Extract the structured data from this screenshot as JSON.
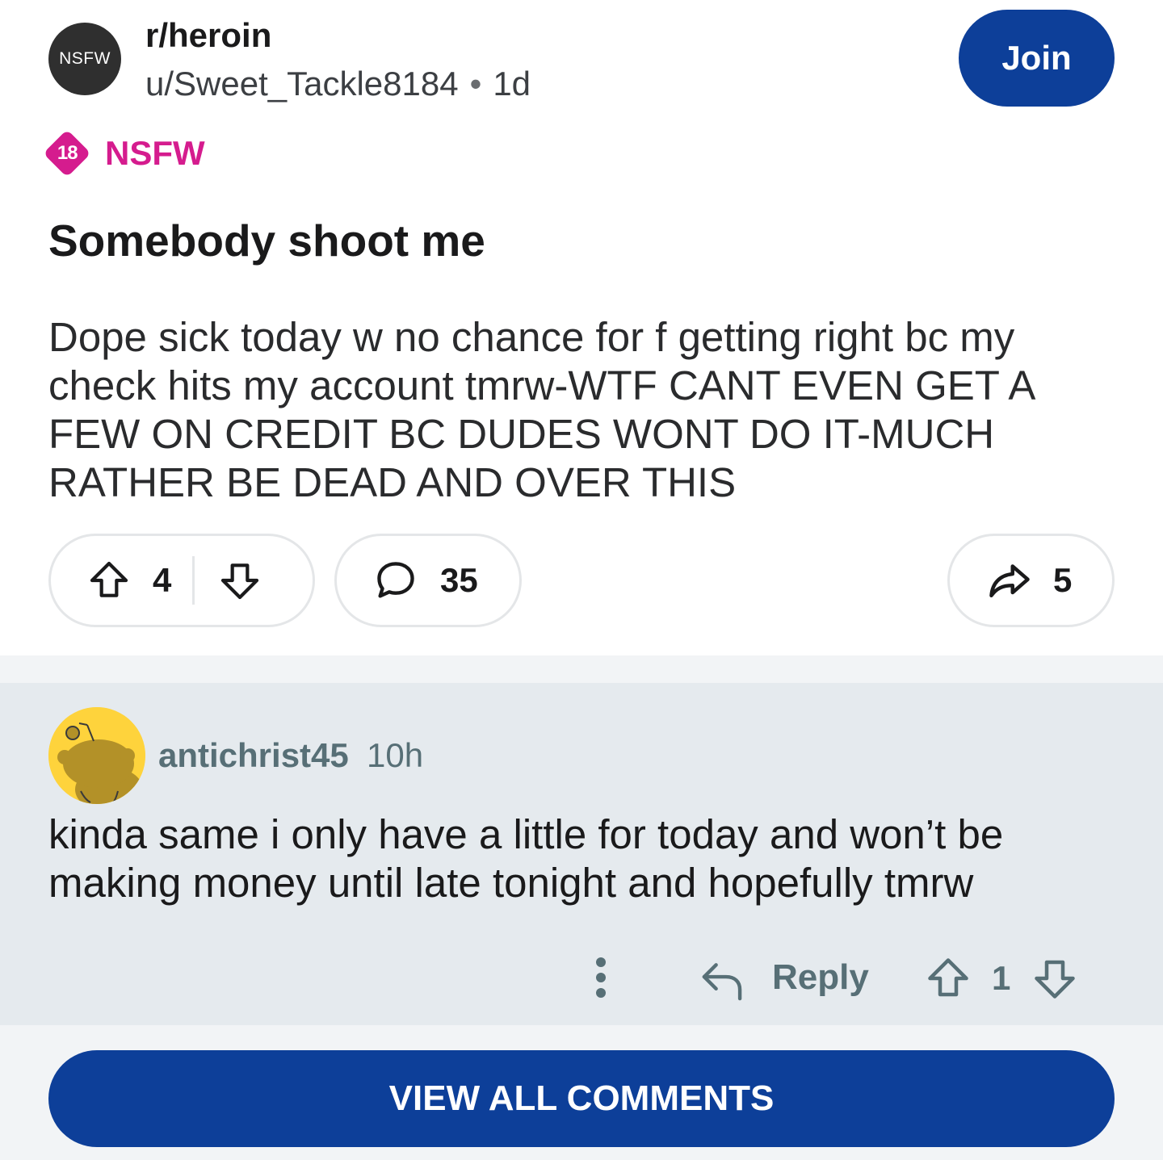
{
  "post": {
    "avatar_label": "NSFW",
    "subreddit": "r/heroin",
    "author": "u/Sweet_Tackle8184",
    "separator": "•",
    "age": "1d",
    "join_label": "Join",
    "nsfw_age": "18",
    "nsfw_label": "NSFW",
    "title": "Somebody shoot me",
    "body": "Dope sick today w no chance for f getting right bc my check hits my account tmrw-WTF CANT EVEN GET A FEW ON CREDIT BC DUDES WONT DO IT-MUCH RATHER BE DEAD AND OVER THIS",
    "upvotes": "4",
    "comments": "35",
    "shares": "5"
  },
  "comment": {
    "username": "antichrist45",
    "age": "10h",
    "body": "kinda same i only have a little for today and won’t be making money until late tonight and hopefully tmrw",
    "reply_label": "Reply",
    "votes": "1"
  },
  "footer": {
    "view_all_label": "VIEW ALL COMMENTS"
  },
  "colors": {
    "brand_blue": "#0d3f99",
    "nsfw_pink": "#d51c8e",
    "comment_bg": "#e5eaee",
    "avatar_yellow": "#fed33c"
  },
  "icons": [
    "upvote-icon",
    "downvote-icon",
    "comment-icon",
    "share-icon",
    "more-icon",
    "reply-icon",
    "snoo-avatar-icon"
  ]
}
